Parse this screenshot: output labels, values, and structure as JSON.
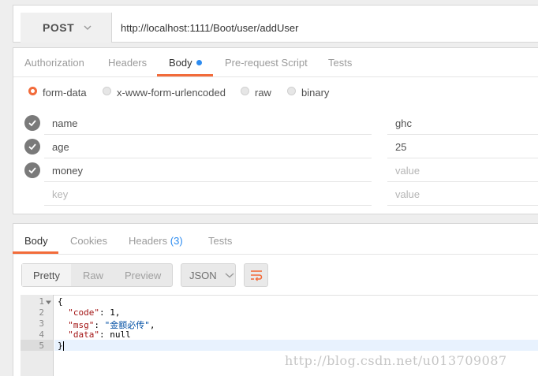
{
  "request": {
    "method": "POST",
    "url": "http://localhost:1111/Boot/user/addUser",
    "tabs": [
      "Authorization",
      "Headers",
      "Body",
      "Pre-request Script",
      "Tests"
    ],
    "active_tab": "Body",
    "body_types": [
      "form-data",
      "x-www-form-urlencoded",
      "raw",
      "binary"
    ],
    "selected_body_type": "form-data",
    "rows": [
      {
        "key": "name",
        "value": "ghc",
        "checked": true
      },
      {
        "key": "age",
        "value": "25",
        "checked": true
      },
      {
        "key": "money",
        "value": "",
        "checked": true
      }
    ],
    "key_placeholder": "key",
    "value_placeholder": "value"
  },
  "response": {
    "tabs": {
      "body": "Body",
      "cookies": "Cookies",
      "headers": "Headers",
      "headers_count": "(3)",
      "tests": "Tests"
    },
    "view_modes": [
      "Pretty",
      "Raw",
      "Preview"
    ],
    "active_view": "Pretty",
    "format": "JSON",
    "line_numbers": [
      "1",
      "2",
      "3",
      "4",
      "5"
    ],
    "code": {
      "open": "{",
      "k1": "\"code\"",
      "v1": "1",
      "k2": "\"msg\"",
      "v2": "\"金额必传\"",
      "k3": "\"data\"",
      "v3": "null",
      "close": "}"
    }
  },
  "watermark": "http://blog.csdn.net/u013709087",
  "colors": {
    "accent": "#f26b3a",
    "link_blue": "#2d8cf0",
    "check_gray": "#7a7a7a"
  },
  "icons": [
    "chevron-down-icon",
    "check-icon",
    "wrap-lines-icon",
    "fold-arrow-icon"
  ]
}
